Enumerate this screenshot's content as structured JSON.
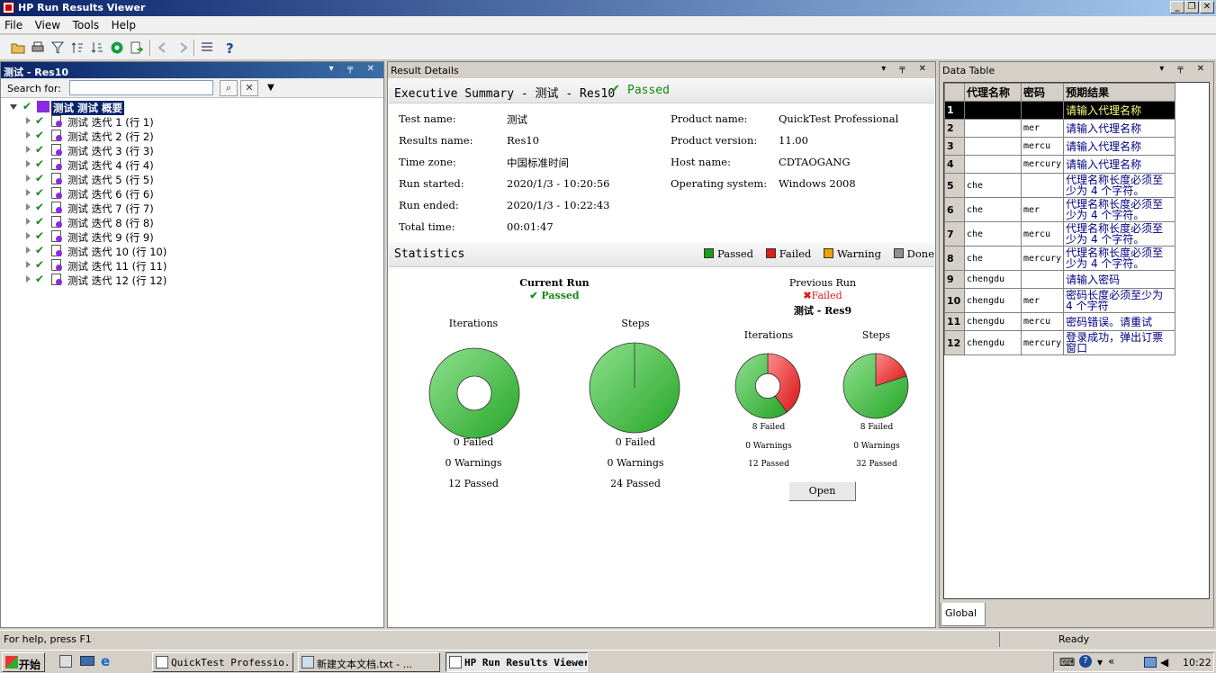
{
  "window": {
    "title": "HP Run Results Viewer",
    "controls": [
      "_",
      "❐",
      "✕"
    ]
  },
  "menu": [
    "File",
    "View",
    "Tools",
    "Help"
  ],
  "left_panel": {
    "title": "测试 - Res10",
    "search_label": "Search for:",
    "search_value": "",
    "root": "测试 测试 概要",
    "items": [
      "测试 迭代 1 (行 1)",
      "测试 迭代 2 (行 2)",
      "测试 迭代 3 (行 3)",
      "测试 迭代 4 (行 4)",
      "测试 迭代 5 (行 5)",
      "测试 迭代 6 (行 6)",
      "测试 迭代 7 (行 7)",
      "测试 迭代 8 (行 8)",
      "测试 迭代 9 (行 9)",
      "测试 迭代 10 (行 10)",
      "测试 迭代 11 (行 11)",
      "测试 迭代 12 (行 12)"
    ]
  },
  "center_panel": {
    "title": "Result Details",
    "summary_title": "Executive Summary - 测试 - Res10",
    "summary_status": "Passed",
    "fields_left": [
      {
        "k": "Test name:",
        "v": "测试"
      },
      {
        "k": "Results name:",
        "v": "Res10"
      },
      {
        "k": "Time zone:",
        "v": "中国标准时间"
      },
      {
        "k": "Run started:",
        "v": "2020/1/3 - 10:20:56"
      },
      {
        "k": "Run ended:",
        "v": "2020/1/3 - 10:22:43"
      },
      {
        "k": "Total time:",
        "v": "00:01:47"
      }
    ],
    "fields_right": [
      {
        "k": "Product name:",
        "v": "QuickTest Professional"
      },
      {
        "k": "Product version:",
        "v": "11.00"
      },
      {
        "k": "Host name:",
        "v": "CDTAOGANG"
      },
      {
        "k": "Operating system:",
        "v": "Windows 2008"
      }
    ],
    "statistics_title": "Statistics",
    "legend": [
      {
        "label": "Passed",
        "color": "#1a9e1a"
      },
      {
        "label": "Failed",
        "color": "#e01c1c"
      },
      {
        "label": "Warning",
        "color": "#f0a000"
      },
      {
        "label": "Done",
        "color": "#909090"
      }
    ],
    "current_run": {
      "title": "Current Run",
      "status": "Passed",
      "iterations": {
        "title": "Iterations",
        "failed": "0 Failed",
        "warnings": "0 Warnings",
        "passed": "12 Passed"
      },
      "steps": {
        "title": "Steps",
        "failed": "0 Failed",
        "warnings": "0 Warnings",
        "passed": "24 Passed"
      }
    },
    "previous_run": {
      "title": "Previous Run",
      "status": "Failed",
      "name": "测试 - Res9",
      "iterations": {
        "title": "Iterations",
        "failed": "8 Failed",
        "warnings": "0 Warnings",
        "passed": "12 Passed"
      },
      "steps": {
        "title": "Steps",
        "failed": "8 Failed",
        "warnings": "0 Warnings",
        "passed": "32 Passed"
      },
      "open_label": "Open"
    }
  },
  "data_table": {
    "title": "Data Table",
    "headers": [
      "代理名称",
      "密码",
      "预期结果"
    ],
    "rows": [
      {
        "n": "1",
        "a": "",
        "b": "",
        "c": "请输入代理名称"
      },
      {
        "n": "2",
        "a": "",
        "b": "mer",
        "c": "请输入代理名称"
      },
      {
        "n": "3",
        "a": "",
        "b": "mercu",
        "c": "请输入代理名称"
      },
      {
        "n": "4",
        "a": "",
        "b": "mercury",
        "c": "请输入代理名称"
      },
      {
        "n": "5",
        "a": "che",
        "b": "",
        "c": "代理名称长度必须至少为 4 个字符。"
      },
      {
        "n": "6",
        "a": "che",
        "b": "mer",
        "c": "代理名称长度必须至少为 4 个字符。"
      },
      {
        "n": "7",
        "a": "che",
        "b": "mercu",
        "c": "代理名称长度必须至少为 4 个字符。"
      },
      {
        "n": "8",
        "a": "che",
        "b": "mercury",
        "c": "代理名称长度必须至少为 4 个字符。"
      },
      {
        "n": "9",
        "a": "chengdu",
        "b": "",
        "c": "请输入密码"
      },
      {
        "n": "10",
        "a": "chengdu",
        "b": "mer",
        "c": "密码长度必须至少为 4 个字符"
      },
      {
        "n": "11",
        "a": "chengdu",
        "b": "mercu",
        "c": "密码错误。请重试"
      },
      {
        "n": "12",
        "a": "chengdu",
        "b": "mercury",
        "c": "登录成功，弹出订票窗口"
      }
    ],
    "sheet_tab": "Global"
  },
  "status": {
    "help": "For help, press F1",
    "state": "Ready"
  },
  "taskbar": {
    "start": "开始",
    "buttons": [
      "QuickTest Professio...",
      "新建文本文档.txt - ...",
      "HP Run Results Viewer"
    ],
    "clock": "10:22"
  },
  "chart_data": [
    {
      "type": "pie",
      "title": "Iterations",
      "run": "Current Run",
      "categories": [
        "Passed",
        "Failed",
        "Warning"
      ],
      "values": [
        12,
        0,
        0
      ]
    },
    {
      "type": "pie",
      "title": "Steps",
      "run": "Current Run",
      "categories": [
        "Passed",
        "Failed",
        "Warning"
      ],
      "values": [
        24,
        0,
        0
      ]
    },
    {
      "type": "pie",
      "title": "Iterations",
      "run": "Previous Run",
      "categories": [
        "Passed",
        "Failed",
        "Warning"
      ],
      "values": [
        12,
        8,
        0
      ]
    },
    {
      "type": "pie",
      "title": "Steps",
      "run": "Previous Run",
      "categories": [
        "Passed",
        "Failed",
        "Warning"
      ],
      "values": [
        32,
        8,
        0
      ]
    }
  ]
}
